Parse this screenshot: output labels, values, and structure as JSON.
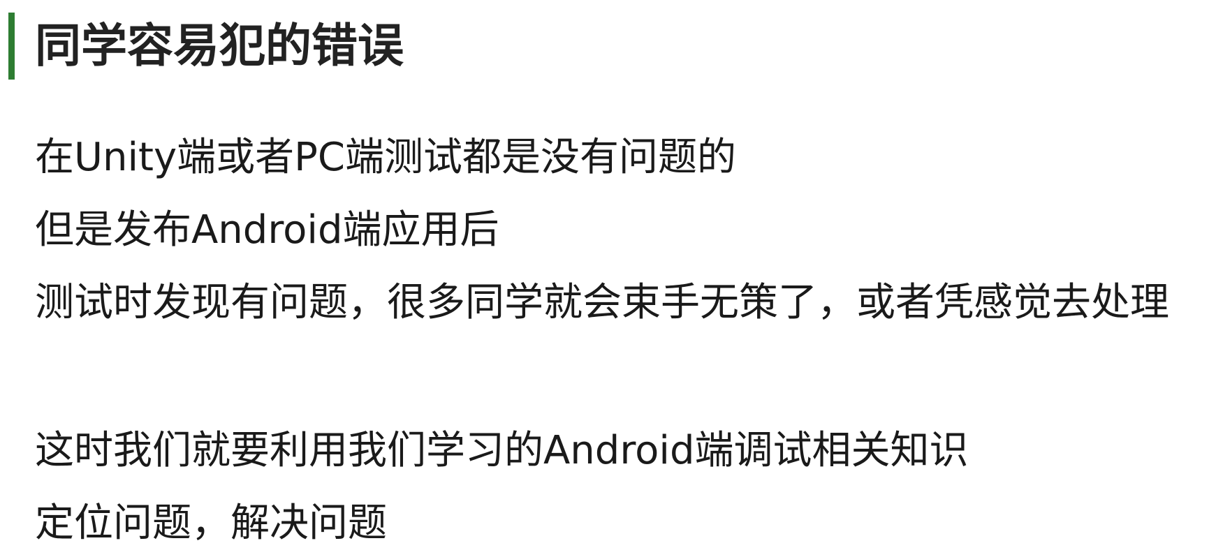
{
  "title": "同学容易犯的错误",
  "accent_color": "#2e7d32",
  "lines": [
    "在Unity端或者PC端测试都是没有问题的",
    "但是发布Android端应用后",
    "测试时发现有问题，很多同学就会束手无策了，或者凭感觉去处理",
    "这时我们就要利用我们学习的Android端调试相关知识",
    "定位问题，解决问题"
  ]
}
